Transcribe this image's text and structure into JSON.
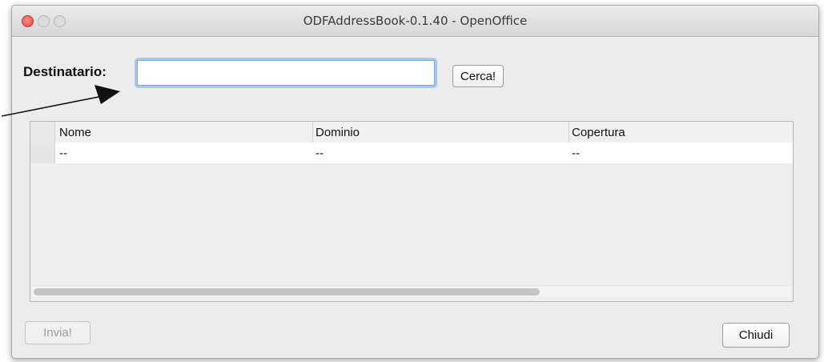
{
  "window": {
    "title": "ODFAddressBook-0.1.40 - OpenOffice"
  },
  "form": {
    "recipient_label": "Destinatario:",
    "recipient_value": "",
    "search_button": "Cerca!"
  },
  "table": {
    "columns": [
      "Nome",
      "Dominio",
      "Copertura"
    ],
    "rows": [
      [
        "--",
        "--",
        "--"
      ]
    ]
  },
  "footer": {
    "send_button": "Invia!",
    "close_button": "Chiudi"
  },
  "colors": {
    "input_focus": "#7aa9dd",
    "close_light": "#e0443a"
  }
}
